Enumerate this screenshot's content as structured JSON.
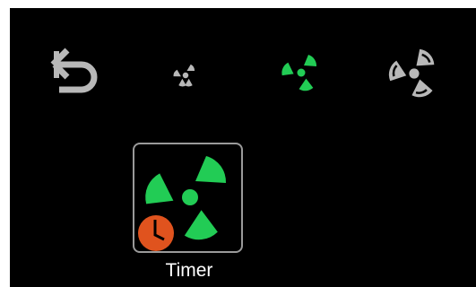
{
  "colors": {
    "background": "#000000",
    "icon_inactive": "#b8b8b8",
    "icon_active": "#22cc55",
    "timer_badge": "#e0531e",
    "tile_border": "#9a9a9a",
    "label_text": "#ffffff"
  },
  "icons": {
    "back": "back-arrow-icon",
    "fan_low": "fan-low-icon",
    "fan_medium": "fan-medium-icon",
    "fan_high": "fan-high-icon",
    "fan_timer": "fan-timer-icon",
    "clock": "clock-icon"
  },
  "fan_speed": {
    "selected": "medium"
  },
  "timer": {
    "label": "Timer"
  }
}
